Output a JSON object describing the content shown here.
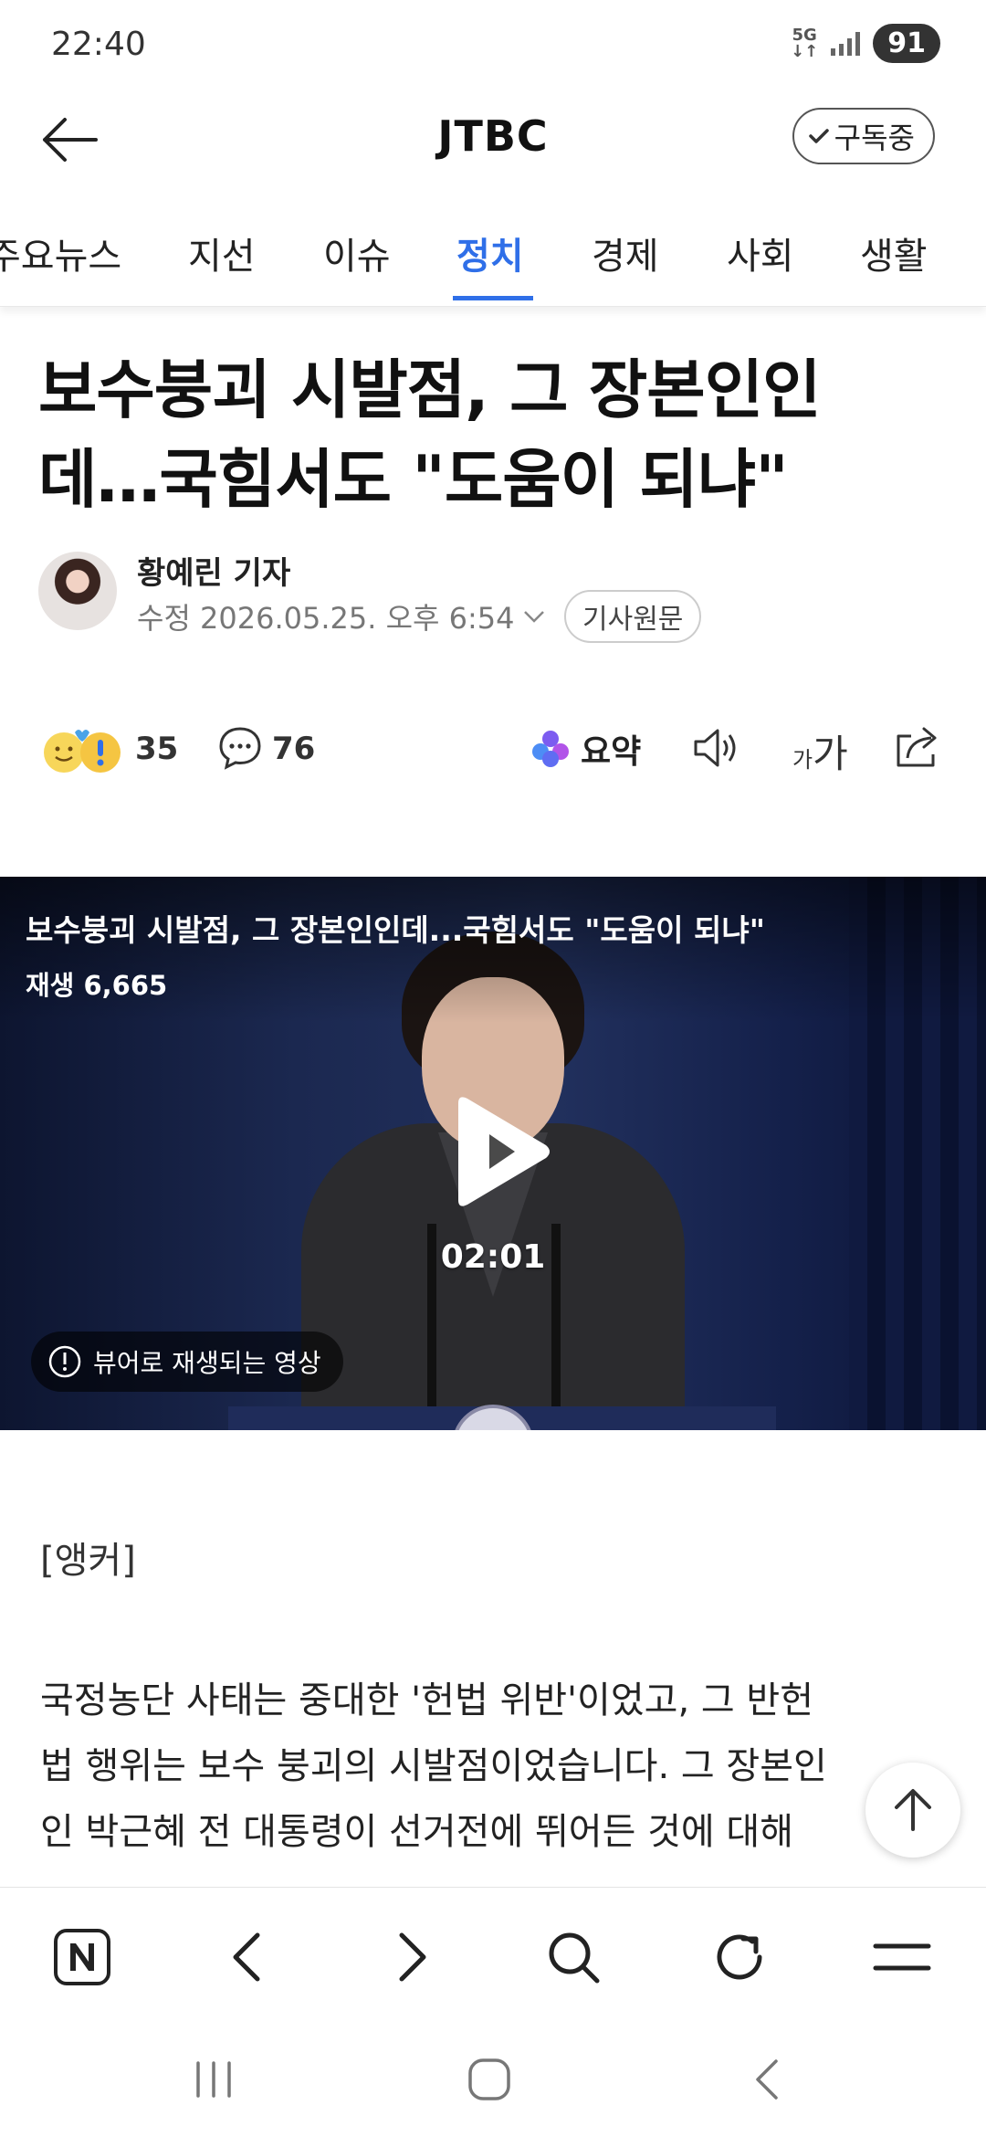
{
  "status_bar": {
    "time": "22:40",
    "network": "5G",
    "battery": "91"
  },
  "header": {
    "brand": "JTBC",
    "subscribe_label": "구독중"
  },
  "tabs": [
    {
      "label": "주요뉴스",
      "active": false
    },
    {
      "label": "지선",
      "active": false
    },
    {
      "label": "이슈",
      "active": false
    },
    {
      "label": "정치",
      "active": true
    },
    {
      "label": "경제",
      "active": false
    },
    {
      "label": "사회",
      "active": false
    },
    {
      "label": "생활",
      "active": false
    }
  ],
  "article": {
    "headline_line1": "보수붕괴 시발점, 그 장본인인",
    "headline_line2": "데…국힘서도 \"도움이 되냐\"",
    "reporter": "황예린 기자",
    "modified": "수정 2026.05.25. 오후 6:54",
    "original_button": "기사원문",
    "reaction_count": "35",
    "comment_count": "76",
    "summary_label": "요약",
    "fontsize_small": "가",
    "fontsize_big": "가"
  },
  "video": {
    "title": "보수붕괴 시발점, 그 장본인인데...국힘서도 \"도움이 되냐\"",
    "views": "재생 6,665",
    "duration": "02:01",
    "notice": "뷰어로 재생되는 영상"
  },
  "body": {
    "anchor_label": "[앵커]",
    "paragraph_lines": [
      "국정농단 사태는 중대한 '헌법 위반'이었고, 그 반헌",
      "법 행위는 보수 붕괴의 시발점이었습니다. 그 장본인",
      "인 박근혜 전 대통령이 선거전에 뛰어든 것에 대해"
    ]
  },
  "icons": {
    "back": "arrow-left-icon",
    "check": "check-icon",
    "comment": "speech-bubble-icon",
    "summary": "sparkle-icon",
    "speaker": "speaker-icon",
    "share": "share-icon",
    "scroll_top": "arrow-up-icon"
  },
  "colors": {
    "accent": "#2f6fe8",
    "video_bg": "#1b2850"
  }
}
